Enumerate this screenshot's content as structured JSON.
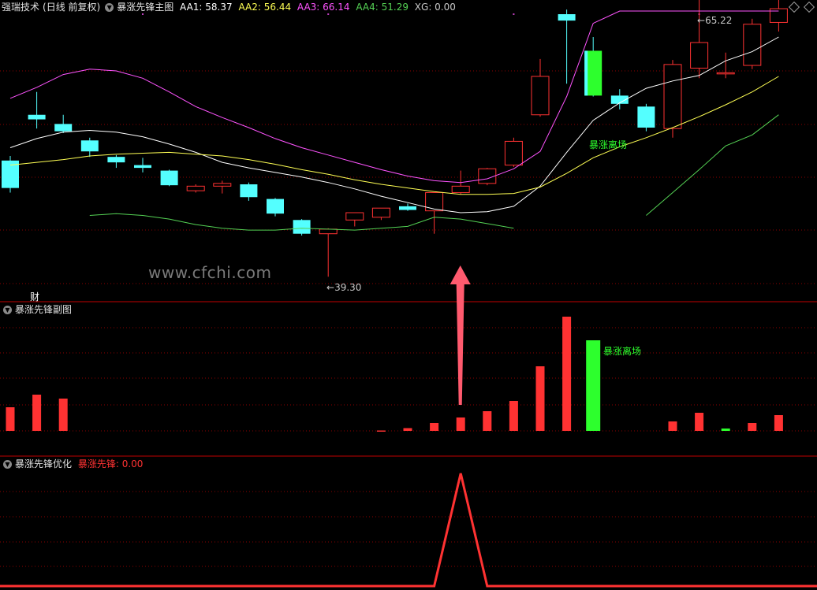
{
  "main_panel": {
    "stock": "强瑞技术",
    "period": "(日线 前复权)",
    "indicator": "暴涨先锋主图",
    "aa1_label": "AA1: 58.37",
    "aa2_label": "AA2: 56.44",
    "aa3_label": "AA3: 66.14",
    "aa4_label": "AA4: 51.29",
    "xg_label": "XG: 0.00",
    "high_mark": "65.22",
    "low_mark": "39.30",
    "cai_label": "财",
    "exit_label": "暴涨离场",
    "watermark": "www.cfchi.com"
  },
  "sub_panel": {
    "title": "暴涨先锋副图",
    "exit_label": "暴涨离场"
  },
  "opt_panel": {
    "title": "暴涨先锋优化",
    "signal_label": "暴涨先锋: 0.00"
  },
  "colors": {
    "up": "#ff3232",
    "down": "#54ffff",
    "aa1": "#ffffff",
    "aa2": "#ffff54",
    "aa3": "#ff54ff",
    "aa4": "#54d254",
    "exit_green": "#2dff2d",
    "grid": "#8b0000",
    "arrow": "#ff5a6e"
  },
  "chart_data": [
    {
      "type": "candlestick",
      "panel": "main",
      "price_range": [
        37,
        68
      ],
      "candles": [
        {
          "o": 52.0,
          "h": 52.5,
          "l": 48.5,
          "c": 49.0
        },
        {
          "o": 57.0,
          "h": 59.5,
          "l": 55.5,
          "c": 56.5
        },
        {
          "o": 56.0,
          "h": 57.0,
          "l": 55.0,
          "c": 55.2
        },
        {
          "o": 54.2,
          "h": 54.5,
          "l": 52.4,
          "c": 53.0
        },
        {
          "o": 52.4,
          "h": 52.6,
          "l": 51.2,
          "c": 51.8
        },
        {
          "o": 51.5,
          "h": 52.3,
          "l": 50.7,
          "c": 51.2
        },
        {
          "o": 50.9,
          "h": 51.0,
          "l": 49.2,
          "c": 49.3
        },
        {
          "o": 48.7,
          "h": 49.4,
          "l": 48.5,
          "c": 49.2
        },
        {
          "o": 49.2,
          "h": 49.8,
          "l": 48.4,
          "c": 49.5
        },
        {
          "o": 49.4,
          "h": 49.6,
          "l": 47.6,
          "c": 48.0
        },
        {
          "o": 47.8,
          "h": 47.9,
          "l": 45.9,
          "c": 46.2
        },
        {
          "o": 45.5,
          "h": 45.6,
          "l": 43.8,
          "c": 44.0
        },
        {
          "o": 44.0,
          "h": 44.6,
          "l": 39.3,
          "c": 44.5
        },
        {
          "o": 45.5,
          "h": 46.0,
          "l": 44.8,
          "c": 46.3
        },
        {
          "o": 45.8,
          "h": 46.5,
          "l": 45.5,
          "c": 46.8
        },
        {
          "o": 47.0,
          "h": 47.3,
          "l": 46.5,
          "c": 46.6
        },
        {
          "o": 46.5,
          "h": 47.0,
          "l": 44.0,
          "c": 48.5
        },
        {
          "o": 48.5,
          "h": 50.9,
          "l": 48.3,
          "c": 49.2
        },
        {
          "o": 49.5,
          "h": 51.2,
          "l": 49.3,
          "c": 51.1
        },
        {
          "o": 51.5,
          "h": 54.5,
          "l": 51.3,
          "c": 54.1
        },
        {
          "o": 57.0,
          "h": 63.1,
          "l": 56.8,
          "c": 61.2
        },
        {
          "o": 68.0,
          "h": 68.5,
          "l": 60.4,
          "c": 67.3
        },
        {
          "o": 64.0,
          "h": 65.5,
          "l": 59.0,
          "c": 59.1
        },
        {
          "o": 59.1,
          "h": 59.8,
          "l": 57.6,
          "c": 58.2
        },
        {
          "o": 57.9,
          "h": 58.2,
          "l": 55.2,
          "c": 55.6
        },
        {
          "o": 55.5,
          "h": 63.0,
          "l": 54.5,
          "c": 62.5
        },
        {
          "o": 62.1,
          "h": 73.1,
          "l": 61.0,
          "c": 64.9
        },
        {
          "o": 61.5,
          "h": 63.8,
          "l": 61.0,
          "c": 61.6
        },
        {
          "o": 62.4,
          "h": 67.5,
          "l": 62.0,
          "c": 66.9
        },
        {
          "o": 67.1,
          "h": 69.9,
          "l": 66.1,
          "c": 68.6
        }
      ],
      "lines": {
        "AA1": [
          53.4,
          54.4,
          55.1,
          55.3,
          55.1,
          54.6,
          53.8,
          52.9,
          51.8,
          51.2,
          50.7,
          50.2,
          49.6,
          48.9,
          48.1,
          47.4,
          46.7,
          46.3,
          46.4,
          47.0,
          49.2,
          52.9,
          56.4,
          58.3,
          59.9,
          60.7,
          61.3,
          62.9,
          63.9,
          65.5
        ],
        "AA2": [
          51.5,
          51.8,
          52.1,
          52.5,
          52.7,
          52.8,
          52.9,
          52.7,
          52.5,
          52.1,
          51.6,
          51.0,
          50.5,
          49.9,
          49.4,
          49.0,
          48.6,
          48.3,
          48.3,
          48.4,
          49.1,
          50.6,
          52.3,
          53.5,
          54.5,
          55.6,
          56.8,
          58.1,
          59.5,
          61.2
        ],
        "AA3": [
          58.8,
          60.0,
          61.4,
          62.0,
          61.8,
          61.0,
          59.5,
          57.9,
          56.7,
          55.6,
          54.4,
          53.4,
          52.6,
          51.8,
          51.0,
          50.3,
          49.8,
          49.6,
          50.0,
          51.1,
          53.0,
          59.0,
          67.0,
          75.4,
          83.5,
          88.0,
          91.0,
          93.5,
          95.0,
          96.0
        ],
        "AA4": [
          null,
          null,
          null,
          46.0,
          46.2,
          46.0,
          45.6,
          45.0,
          44.6,
          44.4,
          44.4,
          44.6,
          44.5,
          44.4,
          44.6,
          44.8,
          45.8,
          45.6,
          45.1,
          44.6,
          null,
          null,
          null,
          null,
          46.0,
          48.5,
          51.0,
          53.6,
          54.8,
          57.0
        ]
      }
    },
    {
      "type": "bar",
      "panel": "sub",
      "title": "暴涨先锋副图",
      "values": [
        3.0,
        4.6,
        4.1,
        0,
        0,
        0,
        0,
        0,
        0,
        0,
        0,
        0,
        0,
        0,
        0.05,
        0.35,
        1.0,
        1.7,
        2.5,
        3.8,
        8.2,
        14.5,
        11.5,
        0,
        0,
        1.2,
        2.3,
        0.3,
        1.0,
        2.0
      ],
      "colors": [
        "red",
        "red",
        "red",
        "red",
        "red",
        "red",
        "red",
        "red",
        "red",
        "red",
        "red",
        "red",
        "red",
        "red",
        "red",
        "red",
        "red",
        "red",
        "red",
        "red",
        "red",
        "red",
        "green",
        "red",
        "red",
        "red",
        "red",
        "green",
        "red",
        "red"
      ]
    },
    {
      "type": "line",
      "panel": "opt",
      "title": "暴涨先锋优化",
      "values": [
        0,
        0,
        0,
        0,
        0,
        0,
        0,
        0,
        0,
        0,
        0,
        0,
        0,
        0,
        0,
        0,
        0,
        1,
        0,
        0,
        0,
        0,
        0,
        0,
        0,
        0,
        0,
        0,
        0,
        0
      ]
    }
  ]
}
